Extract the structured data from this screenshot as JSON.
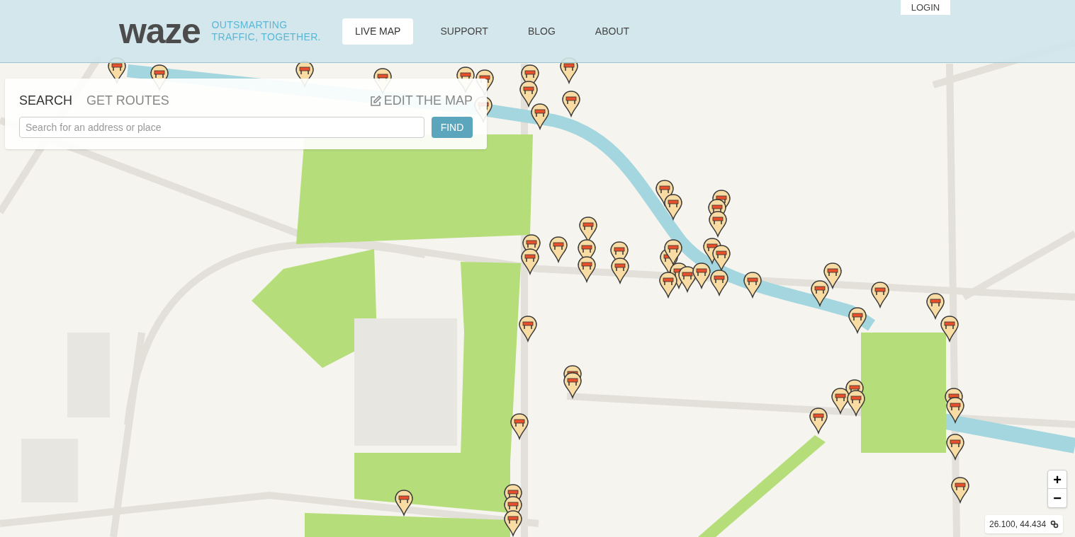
{
  "header": {
    "logo": "waze",
    "tagline": [
      "OUTSMARTING",
      "TRAFFIC, TOGETHER."
    ],
    "nav": [
      {
        "label": "LIVE MAP",
        "selected": true
      },
      {
        "label": "SUPPORT",
        "selected": false
      },
      {
        "label": "BLOG",
        "selected": false
      },
      {
        "label": "ABOUT",
        "selected": false
      }
    ],
    "login": "LOGIN"
  },
  "search_panel": {
    "tabs": [
      {
        "label": "SEARCH",
        "selected": true
      },
      {
        "label": "GET ROUTES",
        "selected": false
      }
    ],
    "edit_link": "EDIT THE MAP",
    "search": {
      "placeholder": "Search for an address or place"
    },
    "find_button": "FIND"
  },
  "map_controls": {
    "zoom_in": "+",
    "zoom_out": "−",
    "coordinates": "26.100, 44.434"
  }
}
